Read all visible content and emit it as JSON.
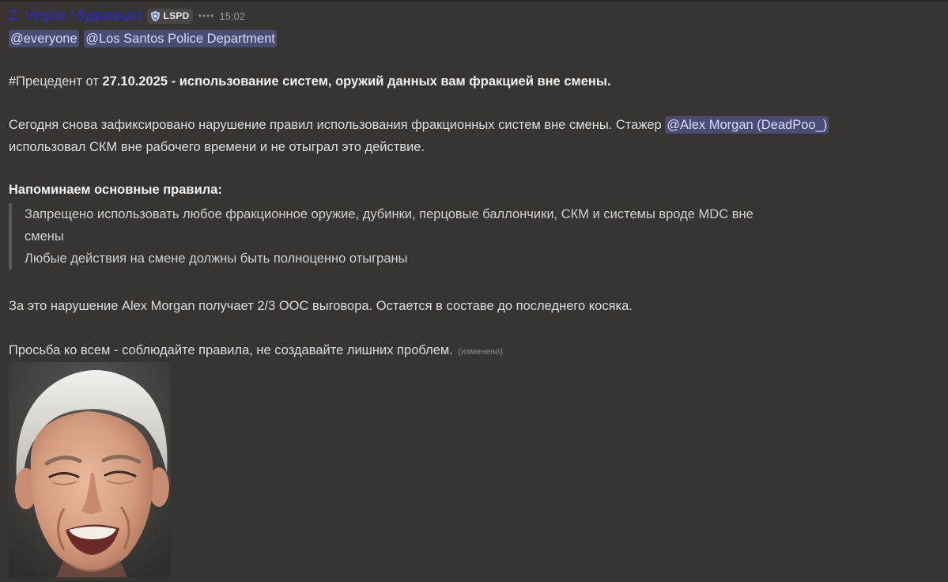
{
  "header": {
    "author": "Z. Virgilio / будапешт)",
    "tag_label": "LSPD",
    "dots": "••••",
    "timestamp": "15:02"
  },
  "mentions": {
    "everyone": "@everyone",
    "role": "@Los Santos Police Department",
    "user": "@Alex Morgan (DeadPoo_)"
  },
  "message": {
    "precedent_prefix": "#Прецедент от",
    "precedent_date": "27.10.2025",
    "precedent_rest": "- использование систем, оружий данных вам фракцией вне смены.",
    "para1_start": "Сегодня снова зафиксировано нарушение правил использования фракционных систем вне смены. Стажер",
    "para1_end": "использовал СКМ вне рабочего времени и не отыграл это действие.",
    "rules_heading": "Напоминаем основные правила:",
    "rules": [
      "Запрещено использовать любое фракционное оружие, дубинки, перцовые баллончики, СКМ и системы вроде MDC вне",
      "смены",
      "Любые действия на смене должны быть полноценно отыграны"
    ],
    "penalty": "За это нарушение Alex Morgan получает 2/3 ООС выговора. Остается в составе до последнего косяка.",
    "request": "Просьба ко всем - соблюдайте правила, не создавайте лишних проблем.",
    "edited": "(изменено)"
  },
  "colors": {
    "background": "#373431",
    "author": "#2b2bd6",
    "mention_bg": "#4a4d73",
    "mention_text": "#d6daff"
  },
  "icons": {
    "tag": "shield-badge-icon",
    "dots": "more-dots-icon"
  }
}
